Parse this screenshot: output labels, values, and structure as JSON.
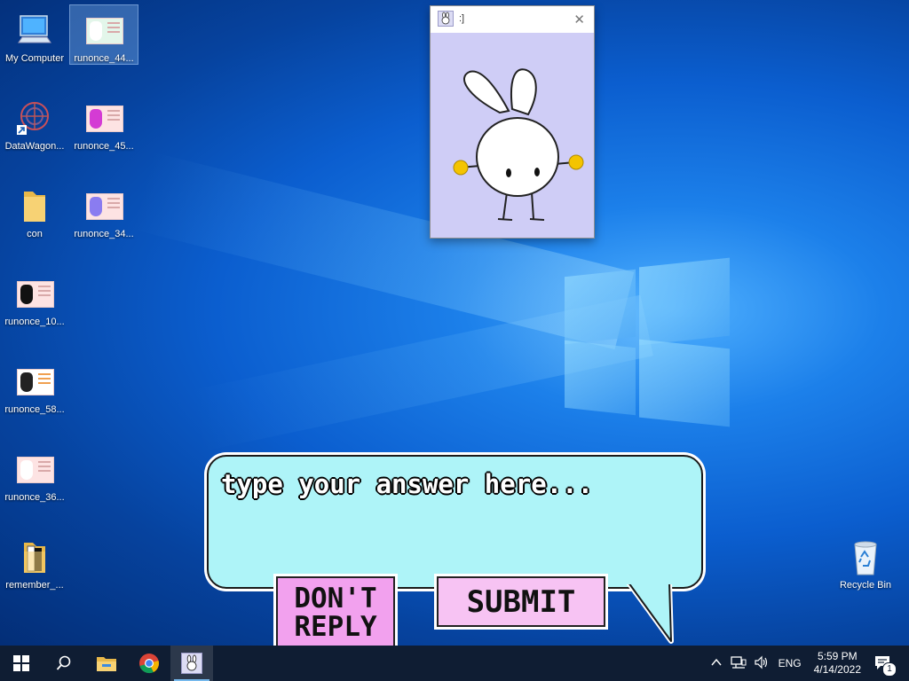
{
  "desktop": {
    "icons": [
      {
        "label": "My Computer"
      },
      {
        "label": "runonce_44..."
      },
      {
        "label": "DataWagon..."
      },
      {
        "label": "runonce_45..."
      },
      {
        "label": "con"
      },
      {
        "label": "runonce_34..."
      },
      {
        "label": "runonce_10..."
      },
      {
        "label": "runonce_58..."
      },
      {
        "label": "runonce_36..."
      },
      {
        "label": "remember_..."
      },
      {
        "label": "Recycle Bin"
      }
    ]
  },
  "popup": {
    "title": ":]",
    "close_icon": "close-icon",
    "background": "#cfcdf6"
  },
  "dialog": {
    "placeholder": "type your answer here...",
    "dont_reply_line1": "DON'T",
    "dont_reply_line2": "REPLY",
    "submit_label": "SUBMIT",
    "bubble_color": "#aef4f8",
    "button_color": "#f6a8f2"
  },
  "taskbar": {
    "time": "5:59 PM",
    "date": "4/14/2022",
    "language": "ENG",
    "notification_count": "1"
  }
}
